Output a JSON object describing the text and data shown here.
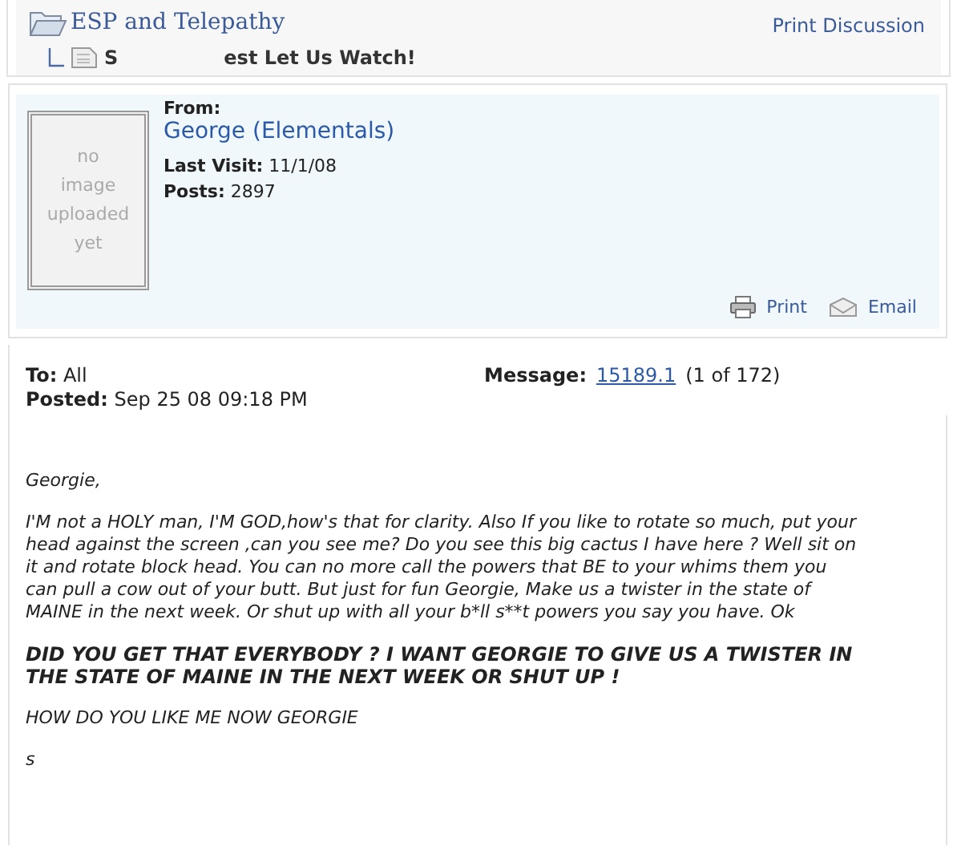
{
  "breadcrumb": {
    "forum": "ESP and Telepathy",
    "print_link": "Print Discussion",
    "thread_start": "S",
    "thread_end": "est Let Us Watch!"
  },
  "author": {
    "avatar_text": "no image uploaded yet",
    "from_label": "From:",
    "name": "George (Elementals)",
    "last_visit_label": "Last Visit:",
    "last_visit": "11/1/08",
    "posts_label": "Posts:",
    "posts": "2897",
    "actions": [
      {
        "kind": "print",
        "label": "Print"
      },
      {
        "kind": "email",
        "label": "Email"
      }
    ]
  },
  "message": {
    "to_label": "To:",
    "to": "All",
    "posted_label": "Posted:",
    "posted": "Sep 25 08 09:18 PM",
    "message_label": "Message:",
    "message_id": "15189.1",
    "position": "(1 of 172)",
    "paragraphs": [
      {
        "kind": "normal",
        "text": "Georgie,"
      },
      {
        "kind": "normal",
        "text": "I'M not a HOLY man, I'M GOD,how's that for clarity. Also If you like to rotate so much, put your head against the screen ,can you see me? Do you see this big cactus I have here ? Well sit on it and rotate block head. You can no more call the powers that BE to your whims them you can pull a cow out of your butt. But just for fun Georgie, Make us a twister in the state of MAINE in the next week. Or shut up with all your b*ll s**t powers you say you have. Ok"
      },
      {
        "kind": "emphasis",
        "text": "DID YOU GET THAT EVERYBODY ? I WANT GEORGIE TO GIVE US A TWISTER IN THE STATE OF MAINE IN THE NEXT WEEK OR SHUT UP !"
      },
      {
        "kind": "normal",
        "text": "HOW DO YOU LIKE ME NOW GEORGIE"
      },
      {
        "kind": "normal",
        "text": "s"
      }
    ]
  }
}
